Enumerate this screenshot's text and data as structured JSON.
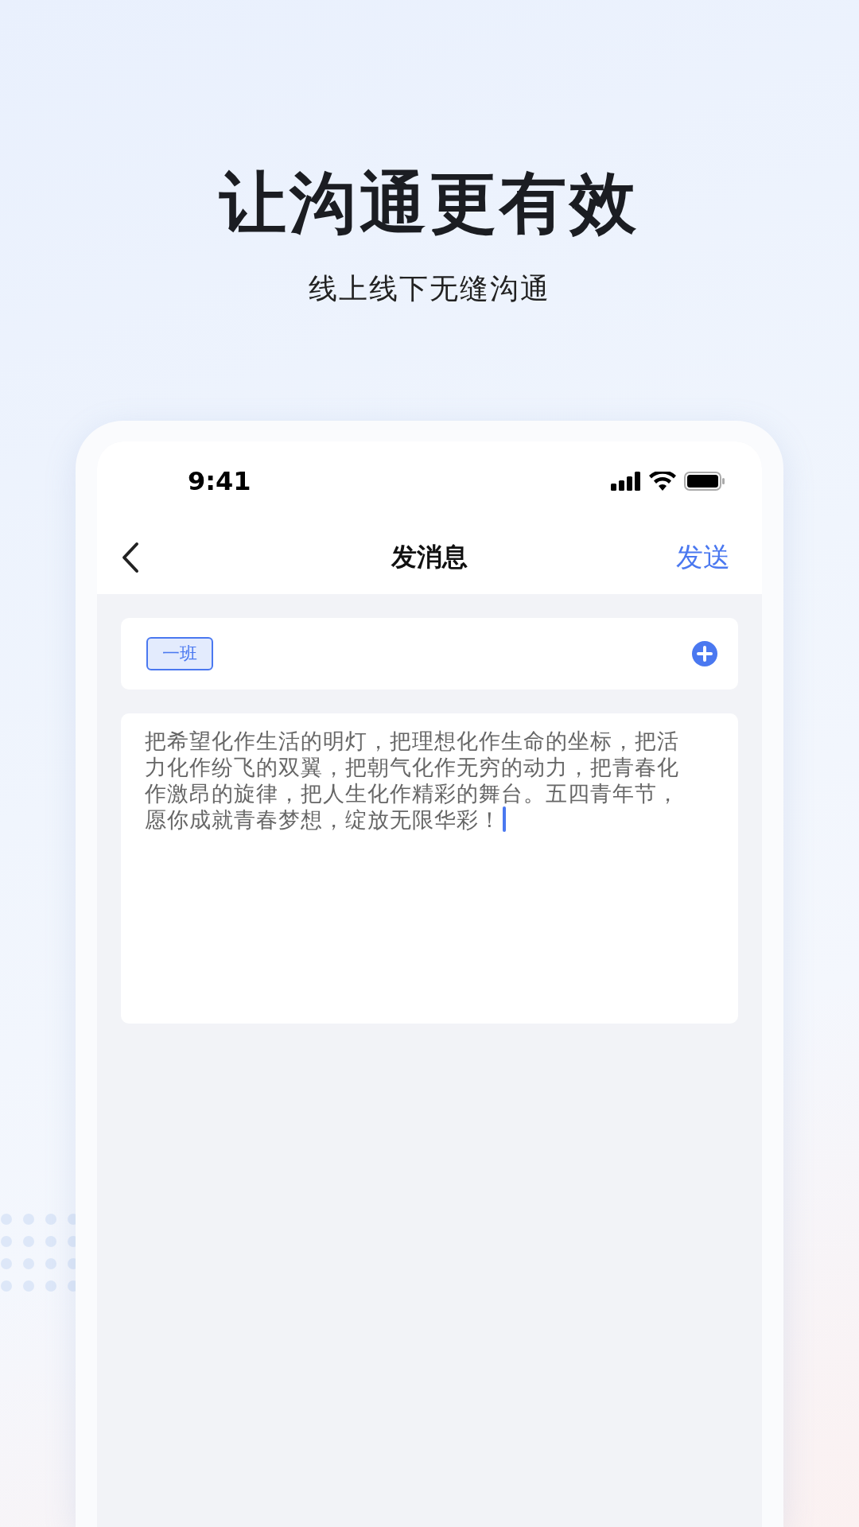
{
  "headline": "让沟通更有效",
  "subtitle": "线上线下无缝沟通",
  "phone": {
    "status_bar": {
      "time": "9:41"
    },
    "nav": {
      "title": "发消息",
      "action": "发送"
    },
    "recipients": [
      {
        "label": "一班",
        "selected": true
      }
    ],
    "message": {
      "value": "把希望化作生活的明灯，把理想化作生命的坐标，把活力化作纷飞的双翼，把朝气化作无穷的动力，把青春化作激昂的旋律，把人生化作精彩的舞台。五四青年节，愿你成就青春梦想，绽放无限华彩！",
      "focused": true
    }
  }
}
